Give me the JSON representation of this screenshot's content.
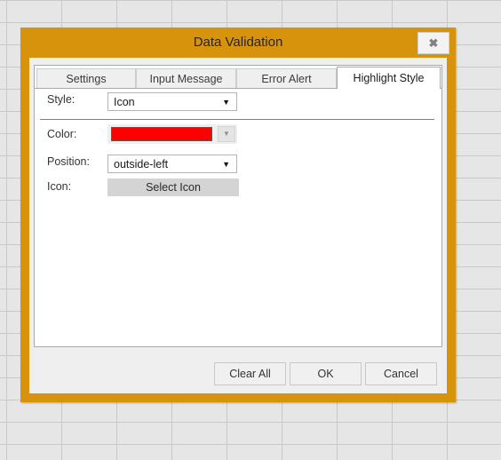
{
  "background": {
    "type": "spreadsheet-grid",
    "cell_fill": "#e6e6e6",
    "gridline_color": "#c9c9c9"
  },
  "dialog": {
    "title": "Data Validation",
    "frame_color": "#d8930d",
    "close_button": {
      "icon": "close-icon",
      "glyph": "✖"
    },
    "tabs": [
      {
        "label": "Settings",
        "active": false
      },
      {
        "label": "Input Message",
        "active": false
      },
      {
        "label": "Error Alert",
        "active": false
      },
      {
        "label": "Highlight Style",
        "active": true
      }
    ],
    "form": {
      "style": {
        "label": "Style:",
        "value": "Icon",
        "caret": "▼"
      },
      "color": {
        "label": "Color:",
        "value": "#ff0000",
        "caret": "▼"
      },
      "position": {
        "label": "Position:",
        "value": "outside-left",
        "caret": "▼"
      },
      "icon": {
        "label": "Icon:",
        "button_label": "Select Icon"
      }
    },
    "footer": {
      "clear_all_label": "Clear All",
      "ok_label": "OK",
      "cancel_label": "Cancel"
    }
  }
}
